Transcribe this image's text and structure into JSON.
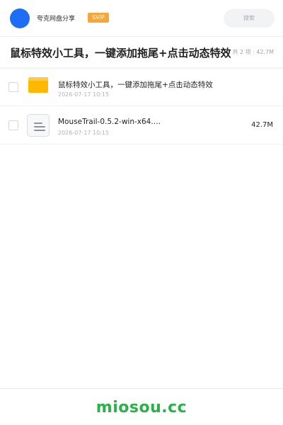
{
  "header": {
    "user_name": "夸克网盘分享",
    "badge": "SVIP",
    "search_placeholder": "搜索"
  },
  "share": {
    "title": "鼠标特效小工具，一键添加拖尾+点击动态特效",
    "meta": "共 2 项 · 42.7M"
  },
  "files": [
    {
      "icon": "folder-icon",
      "name": "鼠标特效小工具，一键添加拖尾+点击动态特效",
      "date": "2026-07-17 10:15",
      "size": ""
    },
    {
      "icon": "document-icon",
      "name": "MouseTrail-0.5.2-win-x64.…",
      "date": "2026-07-17 10:15",
      "size": "42.7M"
    }
  ],
  "footer": {
    "brand": "miosou.cc"
  },
  "colors": {
    "avatar": "#1f6cf5",
    "badge": "#f7a63a",
    "folder": "#ffb800",
    "brand": "#2ab14a"
  }
}
